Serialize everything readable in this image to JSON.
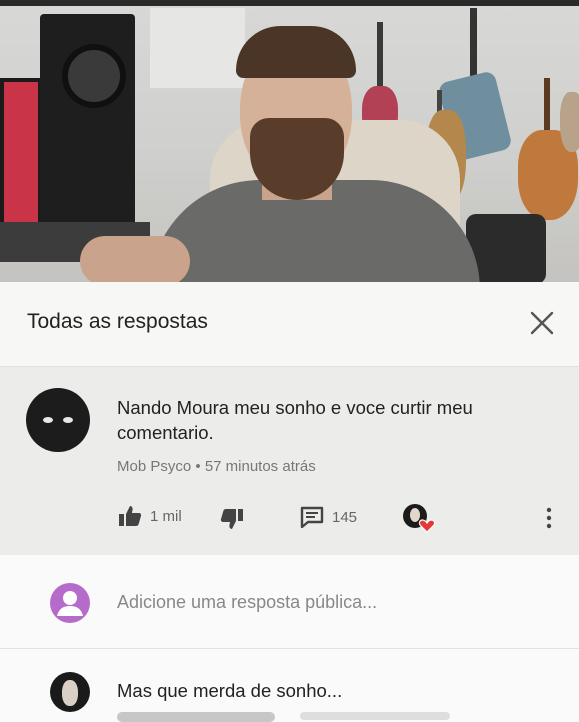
{
  "panel": {
    "title": "Todas as respostas"
  },
  "comment": {
    "text": "Nando Moura meu sonho e voce curtir meu comentario.",
    "author": "Mob Psyco",
    "separator": "•",
    "time": "57 minutos atrás",
    "likes": "1 mil",
    "replies": "145"
  },
  "reply_box": {
    "placeholder": "Adicione uma resposta pública..."
  },
  "reply": {
    "text": "Mas que merda de sonho..."
  },
  "colors": {
    "heart": "#e5383b",
    "reply_avatar": "#b56bc9"
  }
}
